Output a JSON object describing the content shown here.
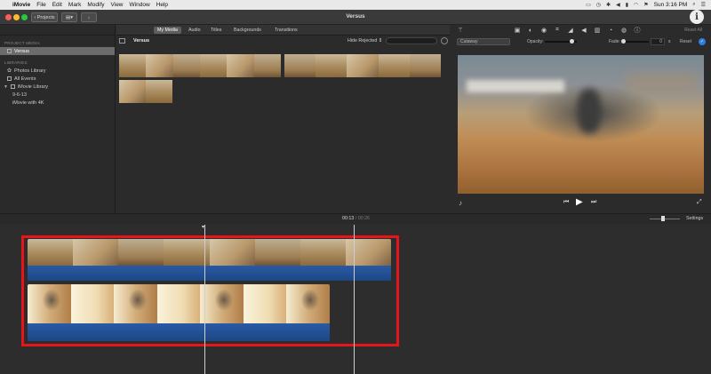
{
  "menubar": {
    "app": "iMovie",
    "items": [
      "File",
      "Edit",
      "Mark",
      "Modify",
      "View",
      "Window",
      "Help"
    ],
    "clock": "Sun 3:16 PM"
  },
  "toolbar": {
    "projects_label": "Projects",
    "title": "Versus"
  },
  "sidebar": {
    "project_media_header": "PROJECT MEDIA",
    "project_item": "Versus",
    "libraries_header": "LIBRARIES",
    "library_items": [
      "Photos Library",
      "All Events",
      "iMovie Library"
    ],
    "events": [
      "9-6-13",
      "iMovie with 4K"
    ]
  },
  "browser": {
    "tabs": [
      "My Media",
      "Audio",
      "Titles",
      "Backgrounds",
      "Transitions"
    ],
    "active_tab": "My Media",
    "event_title": "Versus",
    "filter_label": "Hide Rejected ⇕"
  },
  "viewer": {
    "overlay_mode": "Cutaway",
    "opacity_label": "Opacity:",
    "fade_label": "Fade:",
    "fade_value": "0",
    "fade_unit": "s",
    "reset_label": "Reset",
    "reset_all_label": "Reset All"
  },
  "timeline": {
    "current_time": "00:13",
    "separator": "/",
    "total_time": "00:26",
    "settings_label": "Settings"
  },
  "colors": {
    "highlight": "#e8141b",
    "audio_track": "#1d4784",
    "accent": "#2f7de1"
  }
}
